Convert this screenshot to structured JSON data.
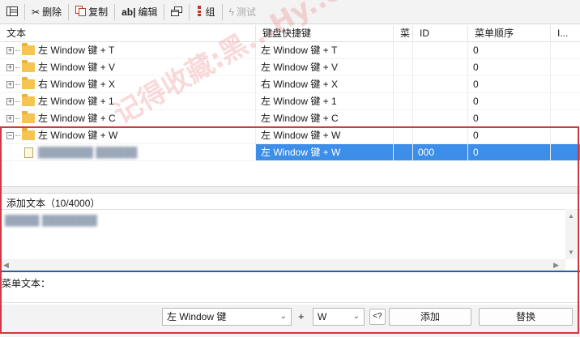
{
  "toolbar": {
    "items": [
      {
        "label": "删除"
      },
      {
        "label": "复制"
      },
      {
        "label": "编辑",
        "prefix": "ab|"
      },
      {
        "label": "组"
      },
      {
        "label": "测试",
        "disabled": true
      }
    ]
  },
  "grid": {
    "columns": [
      "文本",
      "键盘快捷键",
      "菜",
      "ID",
      "菜单顺序",
      "I..."
    ],
    "rows": [
      {
        "text": "左 Window 键 + T",
        "key": "左 Window 键 + T",
        "menu": "",
        "id": "",
        "order": "0",
        "expander": "+"
      },
      {
        "text": "左 Window 键 + V",
        "key": "左 Window 键 + V",
        "menu": "",
        "id": "",
        "order": "0",
        "expander": "+"
      },
      {
        "text": "右 Window 键 + X",
        "key": "右 Window 键 + X",
        "menu": "",
        "id": "",
        "order": "0",
        "expander": "+"
      },
      {
        "text": "左 Window 键 + 1",
        "key": "左 Window 键 + 1",
        "menu": "",
        "id": "",
        "order": "0",
        "expander": "+"
      },
      {
        "text": "左 Window 键 + C",
        "key": "左 Window 键 + C",
        "menu": "",
        "id": "",
        "order": "0",
        "expander": "+"
      },
      {
        "text": "左 Window 键 + W",
        "key": "左 Window 键 + W",
        "menu": "",
        "id": "",
        "order": "0",
        "expander": "−"
      },
      {
        "text": "",
        "key": "左 Window 键 + W",
        "menu": "",
        "id": "000",
        "order": "0",
        "child": true,
        "selected": true
      }
    ]
  },
  "add_text": {
    "label": "添加文本（10/4000）",
    "content": ""
  },
  "menu_text": {
    "label": "菜单文本："
  },
  "bottom": {
    "modifier_select": "左 Window 键",
    "plus": "+",
    "key_select": "W",
    "query_button": "<?",
    "add_button": "添加",
    "replace_button": "替换"
  },
  "watermark": "记得收藏:黑...Hy..com",
  "colors": {
    "selection": "#3d8ee8",
    "highlight_box": "#d4373f",
    "folder": "#f5c451"
  }
}
